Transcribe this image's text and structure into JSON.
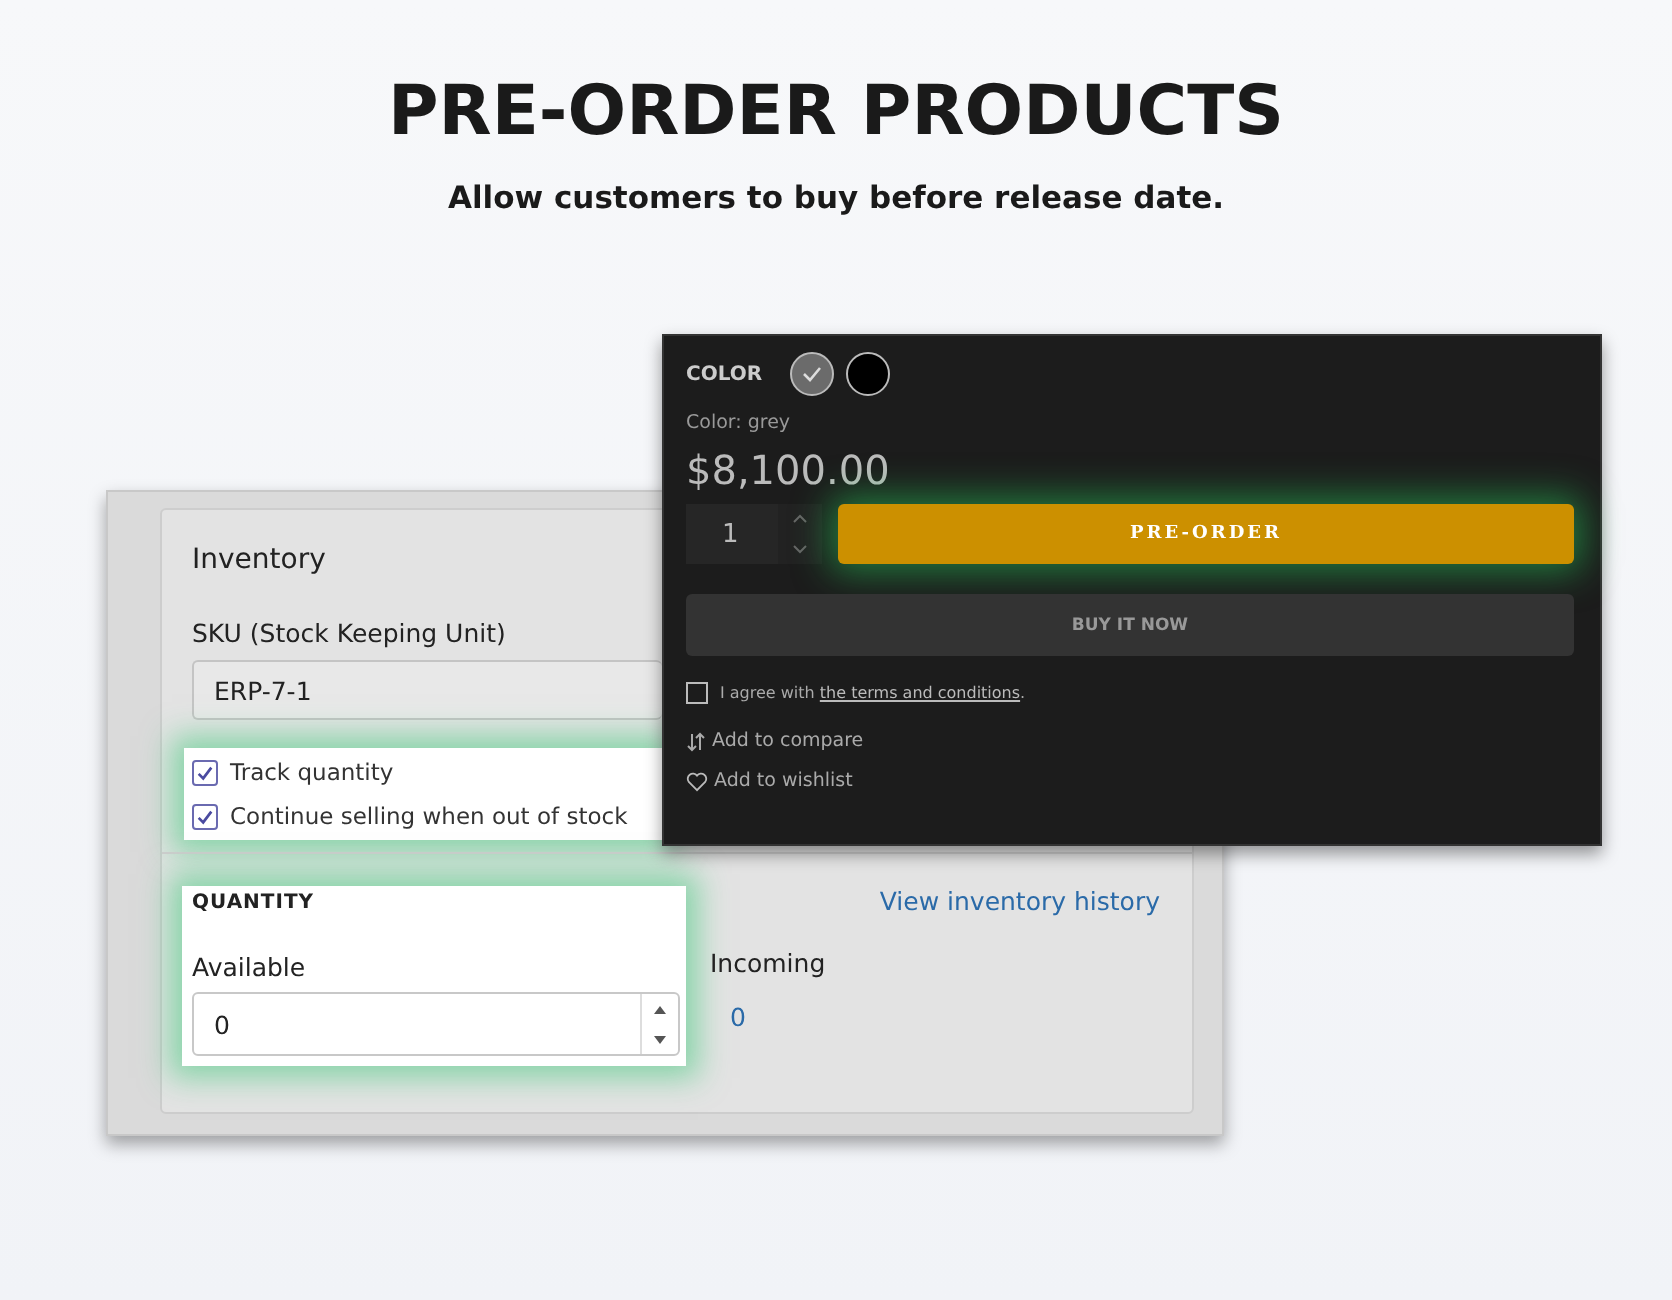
{
  "heading": "PRE-ORDER PRODUCTS",
  "subheading": "Allow customers to buy before release date.",
  "inventory": {
    "title": "Inventory",
    "sku_label": "SKU (Stock Keeping Unit)",
    "sku_value": "ERP-7-1",
    "options": [
      {
        "label": "Track quantity",
        "checked": true
      },
      {
        "label": "Continue selling when out of stock",
        "checked": true
      }
    ],
    "quantity_heading": "QUANTITY",
    "history_link": "View inventory history",
    "available_label": "Available",
    "available_value": "0",
    "incoming_label": "Incoming",
    "incoming_value": "0"
  },
  "product": {
    "color_label": "COLOR",
    "swatches": [
      {
        "color": "#6b6b6b",
        "selected": true
      },
      {
        "color": "#000000",
        "selected": false
      }
    ],
    "color_caption": "Color: grey",
    "price": "$8,100.00",
    "quantity_value": "1",
    "preorder_button": "PRE-ORDER",
    "buy_now_button": "BUY IT NOW",
    "agree": {
      "checked": false,
      "prefix": "I agree with ",
      "link": "the terms and conditions",
      "suffix": "."
    },
    "compare": "Add to compare",
    "wishlist": "Add to wishlist"
  }
}
